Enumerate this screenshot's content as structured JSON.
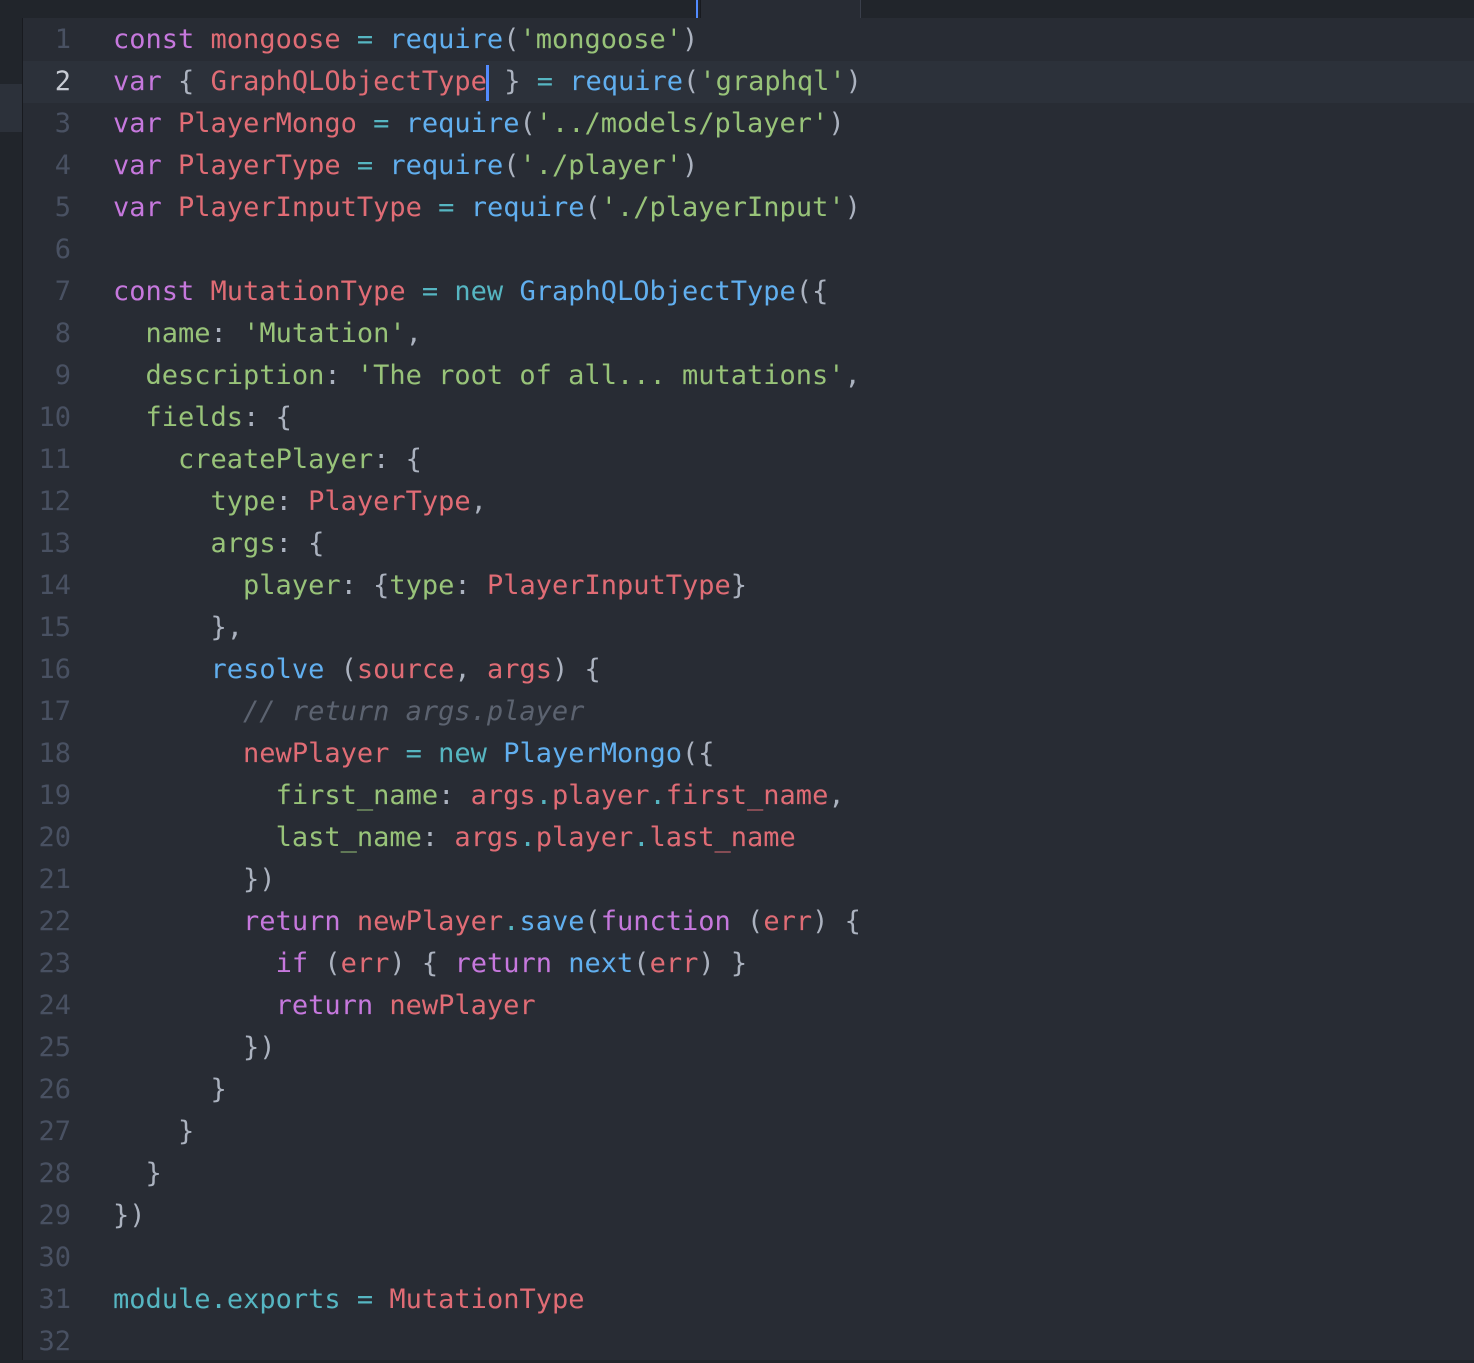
{
  "editor": {
    "current_line": 2,
    "cursor_after_token": "GraphQLObjectType",
    "colors": {
      "background": "#282c34",
      "keyword": "#c678dd",
      "variable": "#e06c75",
      "function": "#61afef",
      "string": "#98c379",
      "property": "#98c379",
      "operator": "#56b6c2",
      "punctuation": "#abb2bf",
      "comment": "#5c6370",
      "line_number": "#495162"
    },
    "lines": [
      {
        "n": "1",
        "tokens": [
          [
            "kw",
            "const"
          ],
          [
            "tx",
            " "
          ],
          [
            "vr",
            "mongoose"
          ],
          [
            "tx",
            " "
          ],
          [
            "op",
            "="
          ],
          [
            "tx",
            " "
          ],
          [
            "fn",
            "require"
          ],
          [
            "pn",
            "("
          ],
          [
            "st",
            "'mongoose'"
          ],
          [
            "pn",
            ")"
          ]
        ]
      },
      {
        "n": "2",
        "tokens": [
          [
            "kw",
            "var"
          ],
          [
            "tx",
            " "
          ],
          [
            "pn",
            "{"
          ],
          [
            "tx",
            " "
          ],
          [
            "vr",
            "GraphQLObjectType"
          ],
          [
            "cursor",
            ""
          ],
          [
            "tx",
            " "
          ],
          [
            "pn",
            "}"
          ],
          [
            "tx",
            " "
          ],
          [
            "op",
            "="
          ],
          [
            "tx",
            " "
          ],
          [
            "fn",
            "require"
          ],
          [
            "pn",
            "("
          ],
          [
            "st",
            "'graphql'"
          ],
          [
            "pn",
            ")"
          ]
        ]
      },
      {
        "n": "3",
        "tokens": [
          [
            "kw",
            "var"
          ],
          [
            "tx",
            " "
          ],
          [
            "vr",
            "PlayerMongo"
          ],
          [
            "tx",
            " "
          ],
          [
            "op",
            "="
          ],
          [
            "tx",
            " "
          ],
          [
            "fn",
            "require"
          ],
          [
            "pn",
            "("
          ],
          [
            "st",
            "'../models/player'"
          ],
          [
            "pn",
            ")"
          ]
        ]
      },
      {
        "n": "4",
        "tokens": [
          [
            "kw",
            "var"
          ],
          [
            "tx",
            " "
          ],
          [
            "vr",
            "PlayerType"
          ],
          [
            "tx",
            " "
          ],
          [
            "op",
            "="
          ],
          [
            "tx",
            " "
          ],
          [
            "fn",
            "require"
          ],
          [
            "pn",
            "("
          ],
          [
            "st",
            "'./player'"
          ],
          [
            "pn",
            ")"
          ]
        ]
      },
      {
        "n": "5",
        "tokens": [
          [
            "kw",
            "var"
          ],
          [
            "tx",
            " "
          ],
          [
            "vr",
            "PlayerInputType"
          ],
          [
            "tx",
            " "
          ],
          [
            "op",
            "="
          ],
          [
            "tx",
            " "
          ],
          [
            "fn",
            "require"
          ],
          [
            "pn",
            "("
          ],
          [
            "st",
            "'./playerInput'"
          ],
          [
            "pn",
            ")"
          ]
        ]
      },
      {
        "n": "6",
        "tokens": []
      },
      {
        "n": "7",
        "tokens": [
          [
            "kw",
            "const"
          ],
          [
            "tx",
            " "
          ],
          [
            "vr",
            "MutationType"
          ],
          [
            "tx",
            " "
          ],
          [
            "op",
            "="
          ],
          [
            "tx",
            " "
          ],
          [
            "op",
            "new"
          ],
          [
            "tx",
            " "
          ],
          [
            "fn",
            "GraphQLObjectType"
          ],
          [
            "pn",
            "({"
          ]
        ]
      },
      {
        "n": "8",
        "tokens": [
          [
            "tx",
            "  "
          ],
          [
            "pr",
            "name"
          ],
          [
            "pn",
            ":"
          ],
          [
            "tx",
            " "
          ],
          [
            "st",
            "'Mutation'"
          ],
          [
            "pn",
            ","
          ]
        ]
      },
      {
        "n": "9",
        "tokens": [
          [
            "tx",
            "  "
          ],
          [
            "pr",
            "description"
          ],
          [
            "pn",
            ":"
          ],
          [
            "tx",
            " "
          ],
          [
            "st",
            "'The root of all... mutations'"
          ],
          [
            "pn",
            ","
          ]
        ]
      },
      {
        "n": "10",
        "tokens": [
          [
            "tx",
            "  "
          ],
          [
            "pr",
            "fields"
          ],
          [
            "pn",
            ":"
          ],
          [
            "tx",
            " "
          ],
          [
            "pn",
            "{"
          ]
        ]
      },
      {
        "n": "11",
        "tokens": [
          [
            "tx",
            "    "
          ],
          [
            "pr",
            "createPlayer"
          ],
          [
            "pn",
            ":"
          ],
          [
            "tx",
            " "
          ],
          [
            "pn",
            "{"
          ]
        ]
      },
      {
        "n": "12",
        "tokens": [
          [
            "tx",
            "      "
          ],
          [
            "pr",
            "type"
          ],
          [
            "pn",
            ":"
          ],
          [
            "tx",
            " "
          ],
          [
            "vr",
            "PlayerType"
          ],
          [
            "pn",
            ","
          ]
        ]
      },
      {
        "n": "13",
        "tokens": [
          [
            "tx",
            "      "
          ],
          [
            "pr",
            "args"
          ],
          [
            "pn",
            ":"
          ],
          [
            "tx",
            " "
          ],
          [
            "pn",
            "{"
          ]
        ]
      },
      {
        "n": "14",
        "tokens": [
          [
            "tx",
            "        "
          ],
          [
            "pr",
            "player"
          ],
          [
            "pn",
            ":"
          ],
          [
            "tx",
            " "
          ],
          [
            "pn",
            "{"
          ],
          [
            "pr",
            "type"
          ],
          [
            "pn",
            ":"
          ],
          [
            "tx",
            " "
          ],
          [
            "vr",
            "PlayerInputType"
          ],
          [
            "pn",
            "}"
          ]
        ]
      },
      {
        "n": "15",
        "tokens": [
          [
            "tx",
            "      "
          ],
          [
            "pn",
            "},"
          ]
        ]
      },
      {
        "n": "16",
        "tokens": [
          [
            "tx",
            "      "
          ],
          [
            "fn",
            "resolve"
          ],
          [
            "tx",
            " "
          ],
          [
            "pn",
            "("
          ],
          [
            "vr",
            "source"
          ],
          [
            "pn",
            ","
          ],
          [
            "tx",
            " "
          ],
          [
            "vr",
            "args"
          ],
          [
            "pn",
            ")"
          ],
          [
            "tx",
            " "
          ],
          [
            "pn",
            "{"
          ]
        ]
      },
      {
        "n": "17",
        "tokens": [
          [
            "tx",
            "        "
          ],
          [
            "cm",
            "// return args.player"
          ]
        ]
      },
      {
        "n": "18",
        "tokens": [
          [
            "tx",
            "        "
          ],
          [
            "vr",
            "newPlayer"
          ],
          [
            "tx",
            " "
          ],
          [
            "op",
            "="
          ],
          [
            "tx",
            " "
          ],
          [
            "op",
            "new"
          ],
          [
            "tx",
            " "
          ],
          [
            "fn",
            "PlayerMongo"
          ],
          [
            "pn",
            "({"
          ]
        ]
      },
      {
        "n": "19",
        "tokens": [
          [
            "tx",
            "          "
          ],
          [
            "pr",
            "first_name"
          ],
          [
            "pn",
            ":"
          ],
          [
            "tx",
            " "
          ],
          [
            "vr",
            "args"
          ],
          [
            "op",
            "."
          ],
          [
            "vr",
            "player"
          ],
          [
            "op",
            "."
          ],
          [
            "vr",
            "first_name"
          ],
          [
            "pn",
            ","
          ]
        ]
      },
      {
        "n": "20",
        "tokens": [
          [
            "tx",
            "          "
          ],
          [
            "pr",
            "last_name"
          ],
          [
            "pn",
            ":"
          ],
          [
            "tx",
            " "
          ],
          [
            "vr",
            "args"
          ],
          [
            "op",
            "."
          ],
          [
            "vr",
            "player"
          ],
          [
            "op",
            "."
          ],
          [
            "vr",
            "last_name"
          ]
        ]
      },
      {
        "n": "21",
        "tokens": [
          [
            "tx",
            "        "
          ],
          [
            "pn",
            "})"
          ]
        ]
      },
      {
        "n": "22",
        "tokens": [
          [
            "tx",
            "        "
          ],
          [
            "kw",
            "return"
          ],
          [
            "tx",
            " "
          ],
          [
            "vr",
            "newPlayer"
          ],
          [
            "op",
            "."
          ],
          [
            "fn",
            "save"
          ],
          [
            "pn",
            "("
          ],
          [
            "kw",
            "function"
          ],
          [
            "tx",
            " "
          ],
          [
            "pn",
            "("
          ],
          [
            "vr",
            "err"
          ],
          [
            "pn",
            ")"
          ],
          [
            "tx",
            " "
          ],
          [
            "pn",
            "{"
          ]
        ]
      },
      {
        "n": "23",
        "tokens": [
          [
            "tx",
            "          "
          ],
          [
            "kw",
            "if"
          ],
          [
            "tx",
            " "
          ],
          [
            "pn",
            "("
          ],
          [
            "vr",
            "err"
          ],
          [
            "pn",
            ")"
          ],
          [
            "tx",
            " "
          ],
          [
            "pn",
            "{"
          ],
          [
            "tx",
            " "
          ],
          [
            "kw",
            "return"
          ],
          [
            "tx",
            " "
          ],
          [
            "fn",
            "next"
          ],
          [
            "pn",
            "("
          ],
          [
            "vr",
            "err"
          ],
          [
            "pn",
            ")"
          ],
          [
            "tx",
            " "
          ],
          [
            "pn",
            "}"
          ]
        ]
      },
      {
        "n": "24",
        "tokens": [
          [
            "tx",
            "          "
          ],
          [
            "kw",
            "return"
          ],
          [
            "tx",
            " "
          ],
          [
            "vr",
            "newPlayer"
          ]
        ]
      },
      {
        "n": "25",
        "tokens": [
          [
            "tx",
            "        "
          ],
          [
            "pn",
            "})"
          ]
        ]
      },
      {
        "n": "26",
        "tokens": [
          [
            "tx",
            "      "
          ],
          [
            "pn",
            "}"
          ]
        ]
      },
      {
        "n": "27",
        "tokens": [
          [
            "tx",
            "    "
          ],
          [
            "pn",
            "}"
          ]
        ]
      },
      {
        "n": "28",
        "tokens": [
          [
            "tx",
            "  "
          ],
          [
            "pn",
            "}"
          ]
        ]
      },
      {
        "n": "29",
        "tokens": [
          [
            "pn",
            "})"
          ]
        ]
      },
      {
        "n": "30",
        "tokens": []
      },
      {
        "n": "31",
        "tokens": [
          [
            "op",
            "module"
          ],
          [
            "op",
            "."
          ],
          [
            "op",
            "exports"
          ],
          [
            "tx",
            " "
          ],
          [
            "op",
            "="
          ],
          [
            "tx",
            " "
          ],
          [
            "vr",
            "MutationType"
          ]
        ]
      },
      {
        "n": "32",
        "tokens": []
      }
    ]
  }
}
